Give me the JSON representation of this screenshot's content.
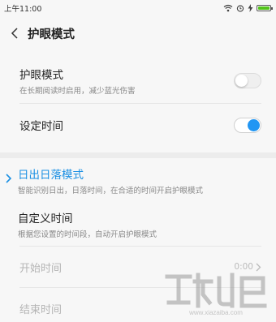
{
  "status": {
    "time": "上午11:00"
  },
  "header": {
    "title": "护眼模式"
  },
  "eye_mode": {
    "title": "护眼模式",
    "subtitle": "在长期阅读时启用，减少蓝光伤害",
    "enabled": false
  },
  "set_time": {
    "title": "设定时间",
    "enabled": true
  },
  "sunrise_mode": {
    "title": "日出日落模式",
    "subtitle": "智能识别日出，日落时间，在合适的时间开启护眼模式",
    "selected": true
  },
  "custom_time": {
    "title": "自定义时间",
    "subtitle": "根据您设置的时间段，自动开启护眼模式",
    "selected": false
  },
  "start_time": {
    "label": "开始时间",
    "value": "0:00"
  },
  "end_time": {
    "label": "结束时间"
  },
  "colors": {
    "accent": "#1a8fe3",
    "toggle_on": "#2196f3",
    "battery": "#52c41a"
  }
}
